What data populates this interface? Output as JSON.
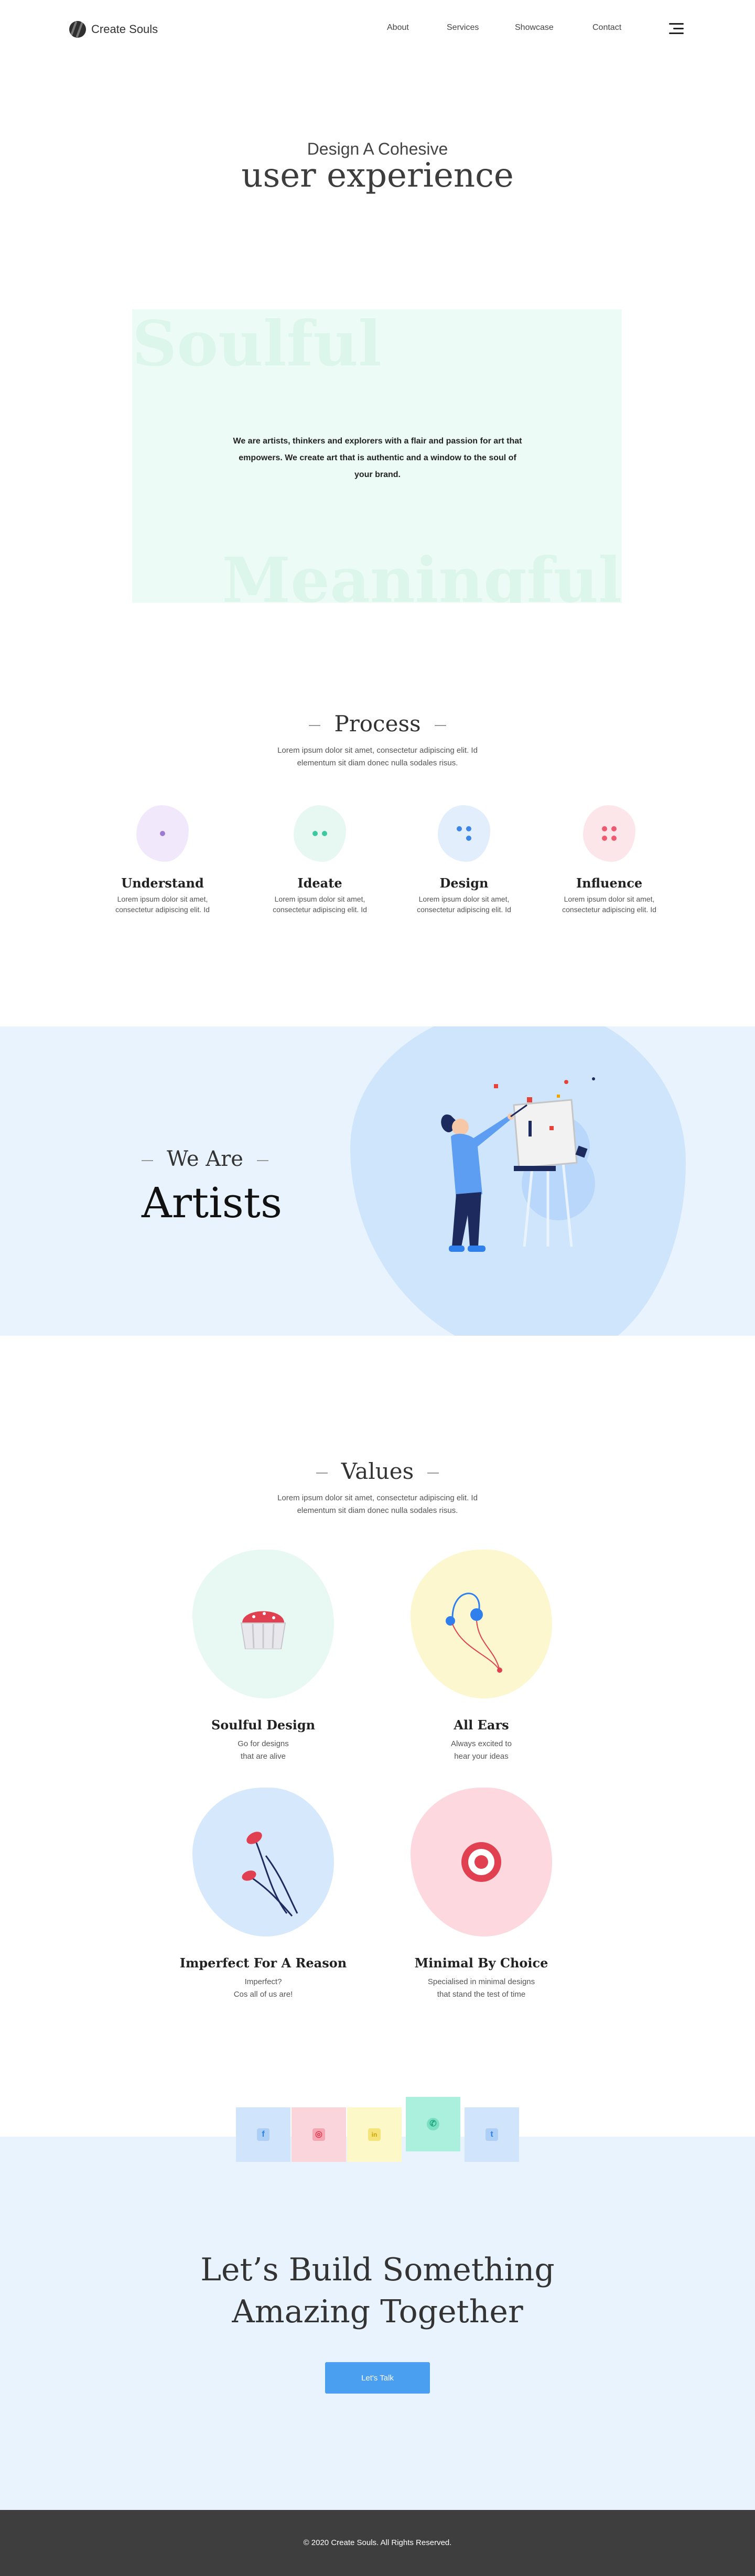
{
  "header": {
    "brand": "Create Souls",
    "nav": [
      {
        "label": "About"
      },
      {
        "label": "Services"
      },
      {
        "label": "Showcase"
      },
      {
        "label": "Contact"
      }
    ]
  },
  "hero": {
    "subtitle": "Design A Cohesive",
    "title": "user experience"
  },
  "intro": {
    "word_top": "Soulful",
    "word_bottom": "Meaningful",
    "text": "We are artists, thinkers and explorers with a flair and passion for art that empowers. We create art that is authentic and a window to the soul of your brand."
  },
  "process": {
    "title": "Process",
    "description": "Lorem ipsum dolor sit amet, consectetur adipiscing elit. Id elementum sit diam donec nulla sodales risus.",
    "steps": [
      {
        "name": "Understand",
        "desc": "Lorem ipsum dolor sit amet, consectetur adipiscing elit. Id",
        "color": "#f1e9fb"
      },
      {
        "name": "Ideate",
        "desc": "Lorem ipsum dolor sit amet, consectetur adipiscing elit. Id",
        "color": "#e6f8f1"
      },
      {
        "name": "Design",
        "desc": "Lorem ipsum dolor sit amet, consectetur adipiscing elit. Id",
        "color": "#e2eefc"
      },
      {
        "name": "Influence",
        "desc": "Lorem ipsum dolor sit amet, consectetur adipiscing elit. Id",
        "color": "#fde6ea"
      }
    ]
  },
  "artists": {
    "prefix": "We Are",
    "title": "Artists"
  },
  "values": {
    "title": "Values",
    "description": "Lorem ipsum dolor sit amet, consectetur adipiscing elit. Id elementum sit diam donec nulla sodales risus.",
    "items": [
      {
        "name": "Soulful Design",
        "line1": "Go for designs",
        "line2": "that are alive",
        "color": "#e8f8f2"
      },
      {
        "name": "All Ears",
        "line1": "Always excited to",
        "line2": "hear your ideas",
        "color": "#fdf7d0"
      },
      {
        "name": "Imperfect For A Reason",
        "line1": "Imperfect?",
        "line2": "Cos all of us are!",
        "color": "#d6e8fc"
      },
      {
        "name": "Minimal By Choice",
        "line1": "Specialised in minimal designs",
        "line2": "that stand the test of time",
        "color": "#fdd8df"
      }
    ]
  },
  "social": [
    {
      "icon": "facebook-icon",
      "glyph": "f",
      "bg": "#d0e5fb",
      "fg": "#2f80ed",
      "ibg": "#aed0f7"
    },
    {
      "icon": "instagram-icon",
      "glyph": "◎",
      "bg": "#fbd5dc",
      "fg": "#e53950",
      "ibg": "#f5a8b4"
    },
    {
      "icon": "linkedin-icon",
      "glyph": "in",
      "bg": "#fdf8c8",
      "fg": "#c7a400",
      "ibg": "#f6e37a"
    },
    {
      "icon": "whatsapp-icon",
      "glyph": "✆",
      "bg": "#aaf0dc",
      "fg": "#1aa782",
      "ibg": "#7ddfc2"
    },
    {
      "icon": "twitter-icon",
      "glyph": "t",
      "bg": "#d0e5fb",
      "fg": "#2f80ed",
      "ibg": "#aed0f7"
    }
  ],
  "cta": {
    "line1": "Let’s Build Something",
    "line2": "Amazing Together",
    "button": "Let's Talk"
  },
  "footer": {
    "copyright": "© 2020 Create Souls. All Rights Reserved."
  }
}
